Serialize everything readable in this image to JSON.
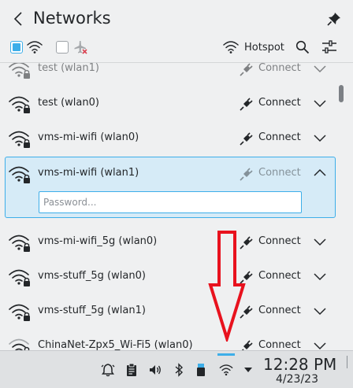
{
  "header": {
    "title": "Networks",
    "back_icon": "chevron-left-icon",
    "pin_icon": "pin-icon"
  },
  "toolbar": {
    "wifi_enabled": true,
    "airplane_mode": false,
    "hotspot_label": "Hotspot",
    "search_icon": "search-icon",
    "config_icon": "configure-icon"
  },
  "networks": [
    {
      "name": "test (wlan1)",
      "action": "Connect",
      "expanded": false
    },
    {
      "name": "test (wlan0)",
      "action": "Connect",
      "expanded": false
    },
    {
      "name": "vms-mi-wifi (wlan0)",
      "action": "Connect",
      "expanded": false
    },
    {
      "name": "vms-mi-wifi (wlan1)",
      "action": "Connect",
      "expanded": true
    },
    {
      "name": "vms-mi-wifi_5g (wlan0)",
      "action": "Connect",
      "expanded": false
    },
    {
      "name": "vms-stuff_5g (wlan0)",
      "action": "Connect",
      "expanded": false
    },
    {
      "name": "vms-stuff_5g (wlan1)",
      "action": "Connect",
      "expanded": false
    },
    {
      "name": "ChinaNet-Zpx5_Wi-Fi5 (wlan0)",
      "action": "Connect",
      "expanded": false
    }
  ],
  "password_field": {
    "placeholder": "Password...",
    "value": ""
  },
  "taskbar": {
    "time": "12:28 PM",
    "date": "4/23/23",
    "tray_icons": [
      "notifications-icon",
      "clipboard-icon",
      "volume-icon",
      "bluetooth-icon",
      "usb-device-icon",
      "wifi-icon",
      "expand-tray-icon"
    ]
  },
  "colors": {
    "accent": "#3daee9",
    "selected_bg": "#d6ebf7",
    "annotation": "#e8121e"
  }
}
